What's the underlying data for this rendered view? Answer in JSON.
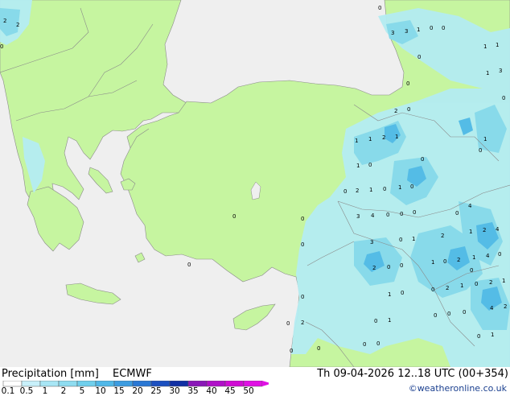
{
  "header": {
    "left_title": "Precipitation [mm]",
    "model": "ECMWF",
    "date": "Th 09-04-2026 12..18 UTC (00+354)"
  },
  "colorbar": {
    "ticks": [
      "0.1",
      "0.5",
      "1",
      "2",
      "5",
      "10",
      "15",
      "20",
      "25",
      "30",
      "35",
      "40",
      "45",
      "50"
    ],
    "colors": [
      "#ffffff",
      "#c8f0fa",
      "#a8e6f5",
      "#8edcf0",
      "#70cfec",
      "#50b8e8",
      "#3c9ce0",
      "#2a78d4",
      "#1c50c0",
      "#1030a4",
      "#8a18b8",
      "#b010c8",
      "#d00cd4",
      "#e010e4"
    ]
  },
  "map_colors": {
    "sea": "#efefef",
    "land": "#c6f5a0",
    "precip_light": "#b4ecf2",
    "precip_moderate": "#88daea",
    "precip_heavy": "#54bce6",
    "border": "#8a8a8a"
  },
  "numbers": [
    {
      "v": "2"
    },
    {
      "v": "2"
    },
    {
      "v": "0"
    },
    {
      "v": "0"
    },
    {
      "v": "3"
    },
    {
      "v": "3"
    },
    {
      "v": "1"
    },
    {
      "v": "0"
    },
    {
      "v": "0"
    },
    {
      "v": "0"
    },
    {
      "v": "1"
    },
    {
      "v": "1"
    },
    {
      "v": "1"
    },
    {
      "v": "3"
    },
    {
      "v": "0"
    },
    {
      "v": "0"
    },
    {
      "v": "2"
    },
    {
      "v": "0"
    },
    {
      "v": "1"
    },
    {
      "v": "1"
    },
    {
      "v": "2"
    },
    {
      "v": "1"
    },
    {
      "v": "1"
    },
    {
      "v": "0"
    },
    {
      "v": "1"
    },
    {
      "v": "0"
    },
    {
      "v": "0"
    },
    {
      "v": "0"
    },
    {
      "v": "2"
    },
    {
      "v": "1"
    },
    {
      "v": "0"
    },
    {
      "v": "1"
    },
    {
      "v": "0"
    },
    {
      "v": "3"
    },
    {
      "v": "4"
    },
    {
      "v": "0"
    },
    {
      "v": "0"
    },
    {
      "v": "0"
    },
    {
      "v": "0"
    },
    {
      "v": "4"
    },
    {
      "v": "0"
    },
    {
      "v": "3"
    },
    {
      "v": "0"
    },
    {
      "v": "1"
    },
    {
      "v": "2"
    },
    {
      "v": "1"
    },
    {
      "v": "2"
    },
    {
      "v": "4"
    },
    {
      "v": "0"
    },
    {
      "v": "2"
    },
    {
      "v": "0"
    },
    {
      "v": "0"
    },
    {
      "v": "1"
    },
    {
      "v": "0"
    },
    {
      "v": "2"
    },
    {
      "v": "1"
    },
    {
      "v": "4"
    },
    {
      "v": "0"
    },
    {
      "v": "0"
    },
    {
      "v": "2"
    },
    {
      "v": "1"
    },
    {
      "v": "2"
    },
    {
      "v": "1"
    },
    {
      "v": "0"
    },
    {
      "v": "1"
    },
    {
      "v": "0"
    },
    {
      "v": "0"
    },
    {
      "v": "0"
    },
    {
      "v": "4"
    },
    {
      "v": "2"
    },
    {
      "v": "0"
    },
    {
      "v": "2"
    },
    {
      "v": "0"
    },
    {
      "v": "1"
    },
    {
      "v": "0"
    },
    {
      "v": "0"
    },
    {
      "v": "0"
    },
    {
      "v": "0"
    },
    {
      "v": "1"
    },
    {
      "v": "0"
    },
    {
      "v": "0"
    },
    {
      "v": "0"
    },
    {
      "v": "0"
    },
    {
      "v": "0"
    },
    {
      "v": "0"
    }
  ],
  "credit": "©weatheronline.co.uk"
}
